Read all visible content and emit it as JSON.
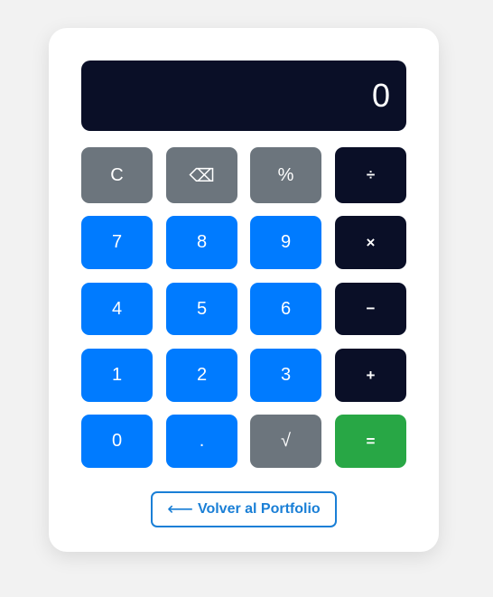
{
  "display": {
    "value": "0"
  },
  "keys": {
    "clear": "C",
    "backspace": "⌫",
    "percent": "%",
    "divide": "÷",
    "seven": "7",
    "eight": "8",
    "nine": "9",
    "multiply": "×",
    "four": "4",
    "five": "5",
    "six": "6",
    "subtract": "−",
    "one": "1",
    "two": "2",
    "three": "3",
    "add": "+",
    "zero": "0",
    "decimal": ".",
    "sqrt": "√",
    "equals": "="
  },
  "back_link": {
    "arrow": "⟵",
    "label": "Volver al Portfolio"
  },
  "colors": {
    "background": "#f2f2f2",
    "card": "#ffffff",
    "display": "#0a0f27",
    "function_key": "#6c757d",
    "number_key": "#007bff",
    "operator_key": "#0a0f27",
    "equals_key": "#28a745",
    "link": "#1a7fd6"
  }
}
